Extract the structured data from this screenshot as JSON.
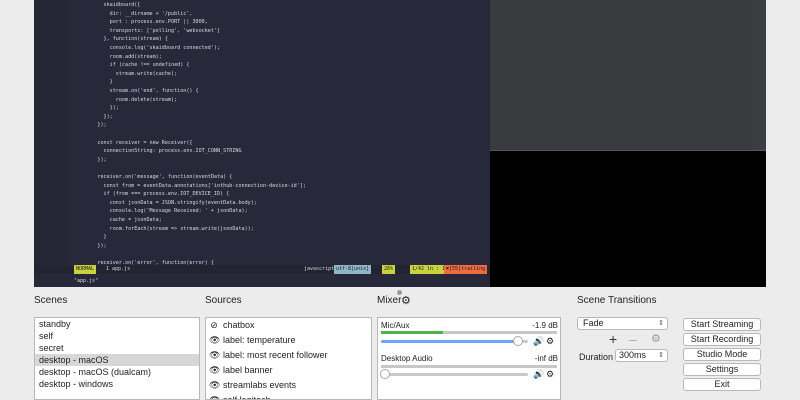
{
  "editor": {
    "lines": [
      {
        "t": "        skaidboard({",
        "c": ""
      },
      {
        "t": "          dir: __dirname + '/public',",
        "c": ""
      },
      {
        "t": "          port : process.env.PORT || 3000,",
        "c": ""
      },
      {
        "t": "          transports: ['polling', 'websocket']",
        "c": ""
      },
      {
        "t": "        }, function(stream) {",
        "c": ""
      },
      {
        "t": "          console.log('skaidboard connected');",
        "c": ""
      },
      {
        "t": "          room.add(stream);",
        "c": ""
      },
      {
        "t": "          if (cache !== undefined) {",
        "c": ""
      },
      {
        "t": "            stream.write(cache);",
        "c": ""
      },
      {
        "t": "          }",
        "c": ""
      },
      {
        "t": "          stream.on('end', function() {",
        "c": ""
      },
      {
        "t": "            room.delete(stream);",
        "c": ""
      },
      {
        "t": "          });",
        "c": ""
      },
      {
        "t": "        });",
        "c": ""
      },
      {
        "t": "      });",
        "c": ""
      },
      {
        "t": "",
        "c": ""
      },
      {
        "t": "      const receiver = new Receiver({",
        "c": ""
      },
      {
        "t": "        connectionString: process.env.IOT_CONN_STRING",
        "c": ""
      },
      {
        "t": "      });",
        "c": ""
      },
      {
        "t": "",
        "c": ""
      },
      {
        "t": "      receiver.on('message', function(eventData) {",
        "c": ""
      },
      {
        "t": "        const from = eventData.annotations['iothub-connection-device-id'];",
        "c": ""
      },
      {
        "t": "        if (from === process.env.IOT_DEVICE_ID) {",
        "c": ""
      },
      {
        "t": "          const jsonData = JSON.stringify(eventData.body);",
        "c": ""
      },
      {
        "t": "          console.log('Message Received: ' + jsonData);",
        "c": ""
      },
      {
        "t": "          cache = jsonData;",
        "c": ""
      },
      {
        "t": "          room.forEach(stream => stream.write(jsonData));",
        "c": ""
      },
      {
        "t": "        }",
        "c": ""
      },
      {
        "t": "      });",
        "c": ""
      },
      {
        "t": "",
        "c": ""
      },
      {
        "t": "      receiver.on('error', function(error) {",
        "c": ""
      }
    ],
    "status_mode": "NORMAL",
    "status_file": "1 app.js",
    "status_lang": "javascript",
    "status_enc": "utf-8[unix]",
    "status_pct": "26%",
    "status_pos": "1/42 ln : 1",
    "status_trail": "✖[55]trailing",
    "cmdline": "\"app.js\" "
  },
  "panels": {
    "scenes_title": "Scenes",
    "sources_title": "Sources",
    "mixer_title": "Mixer",
    "transitions_title": "Scene Transitions"
  },
  "scenes": [
    {
      "label": "standby",
      "selected": false
    },
    {
      "label": "self",
      "selected": false
    },
    {
      "label": "secret",
      "selected": false
    },
    {
      "label": "desktop - macOS",
      "selected": true
    },
    {
      "label": "desktop - macOS (dualcam)",
      "selected": false
    },
    {
      "label": "desktop - windows",
      "selected": false
    }
  ],
  "sources": [
    {
      "label": "chatbox",
      "visible": false
    },
    {
      "label": "label: temperature",
      "visible": true
    },
    {
      "label": "label: most recent follower",
      "visible": true
    },
    {
      "label": "label banner",
      "visible": true
    },
    {
      "label": "streamlabs events",
      "visible": true
    },
    {
      "label": "self logitech",
      "visible": true
    }
  ],
  "mixer": {
    "channels": [
      {
        "name": "Mic/Aux",
        "db": "-1.9 dB",
        "level": 0.35,
        "volume": 0.93
      },
      {
        "name": "Desktop Audio",
        "db": "-inf dB",
        "level": 0.0,
        "volume": 0.0
      }
    ]
  },
  "transitions": {
    "selected": "Fade",
    "duration_label": "Duration",
    "duration_value": "300ms"
  },
  "controls": {
    "start_streaming": "Start Streaming",
    "start_recording": "Start Recording",
    "studio_mode": "Studio Mode",
    "settings": "Settings",
    "exit": "Exit"
  },
  "colors": {
    "meter_green": "#4fb34a",
    "slider_blue": "#6ba7f5",
    "selection_grey": "#d7d7d7"
  }
}
